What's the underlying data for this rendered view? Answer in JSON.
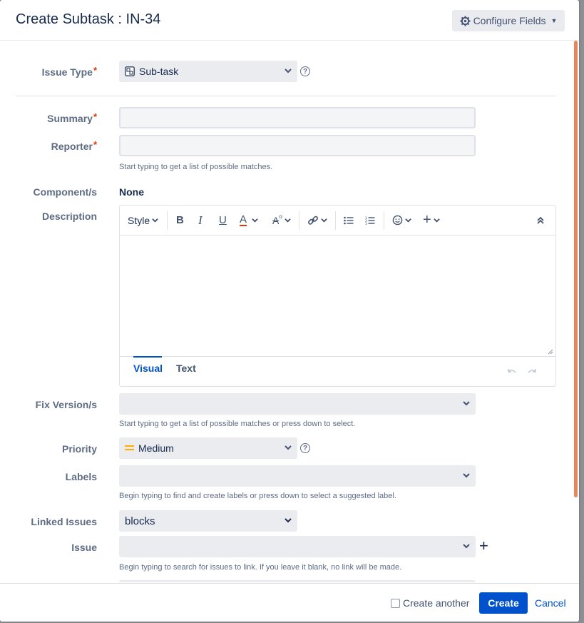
{
  "dialog": {
    "title": "Create Subtask : IN-34",
    "configure_label": "Configure Fields"
  },
  "fields": {
    "issue_type": {
      "label": "Issue Type",
      "value": "Sub-task"
    },
    "summary": {
      "label": "Summary",
      "value": ""
    },
    "reporter": {
      "label": "Reporter",
      "value": "",
      "hint": "Start typing to get a list of possible matches."
    },
    "components": {
      "label": "Component/s",
      "value": "None"
    },
    "description": {
      "label": "Description",
      "toolbar": {
        "style": "Style"
      },
      "tabs": [
        "Visual",
        "Text"
      ]
    },
    "fix_versions": {
      "label": "Fix Version/s",
      "value": "",
      "hint": "Start typing to get a list of possible matches or press down to select."
    },
    "priority": {
      "label": "Priority",
      "value": "Medium"
    },
    "labels": {
      "label": "Labels",
      "value": "",
      "hint": "Begin typing to find and create labels or press down to select a suggested label."
    },
    "linked_issues": {
      "label": "Linked Issues",
      "value": "blocks"
    },
    "issue": {
      "label": "Issue",
      "value": "",
      "hint": "Begin typing to search for issues to link. If you leave it blank, no link will be made."
    }
  },
  "footer": {
    "create_another": "Create another",
    "create": "Create",
    "cancel": "Cancel"
  },
  "colors": {
    "primary": "#0052cc",
    "required": "#de350b",
    "priority_medium": "#ffab00",
    "scroll_thumb": "#e9855b"
  }
}
